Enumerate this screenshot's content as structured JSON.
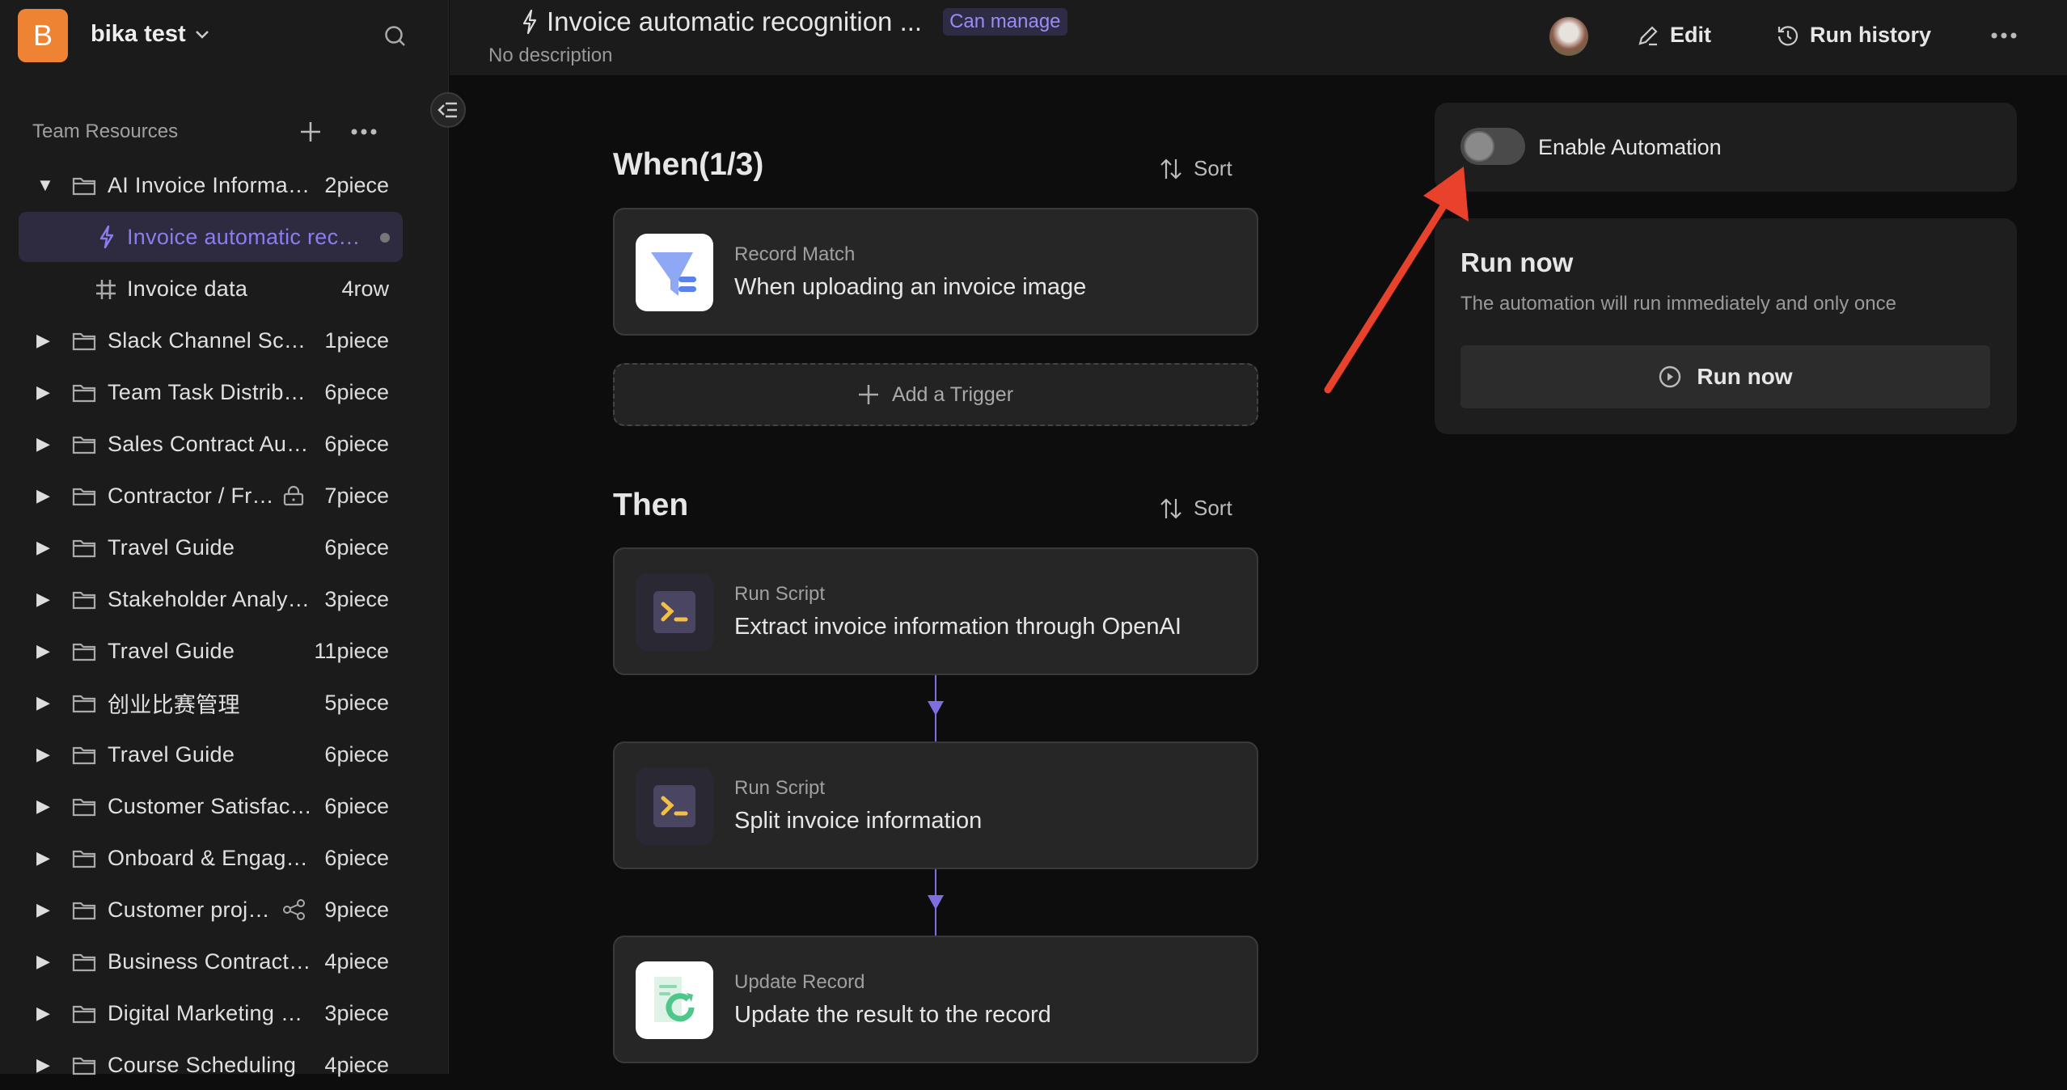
{
  "workspace": {
    "logo_letter": "B",
    "name": "bika test",
    "logo_color": "#ee8433"
  },
  "sidebar": {
    "section_label": "Team Resources",
    "items": [
      {
        "label": "AI Invoice Informa…",
        "count": "2piece",
        "type": "folder",
        "expanded": true
      },
      {
        "label": "Invoice automatic rec…",
        "count": "",
        "type": "automation",
        "selected": true
      },
      {
        "label": "Invoice data",
        "count": "4row",
        "type": "database"
      },
      {
        "label": "Slack Channel Sc…",
        "count": "1piece",
        "type": "folder"
      },
      {
        "label": "Team Task Distrib…",
        "count": "6piece",
        "type": "folder"
      },
      {
        "label": "Sales Contract Au…",
        "count": "6piece",
        "type": "folder"
      },
      {
        "label": "Contractor / Fr…",
        "count": "7piece",
        "type": "folder",
        "icon": "lock-icon"
      },
      {
        "label": "Travel Guide",
        "count": "6piece",
        "type": "folder"
      },
      {
        "label": "Stakeholder Analy…",
        "count": "3piece",
        "type": "folder"
      },
      {
        "label": "Travel Guide",
        "count": "11piece",
        "type": "folder"
      },
      {
        "label": "创业比赛管理",
        "count": "5piece",
        "type": "folder"
      },
      {
        "label": "Travel Guide",
        "count": "6piece",
        "type": "folder"
      },
      {
        "label": "Customer Satisfac…",
        "count": "6piece",
        "type": "folder"
      },
      {
        "label": "Onboard & Engag…",
        "count": "6piece",
        "type": "folder"
      },
      {
        "label": "Customer proj…",
        "count": "9piece",
        "type": "folder",
        "icon": "share-icon"
      },
      {
        "label": "Business Contract…",
        "count": "4piece",
        "type": "folder"
      },
      {
        "label": "Digital Marketing …",
        "count": "3piece",
        "type": "folder"
      },
      {
        "label": "Course Scheduling",
        "count": "4piece",
        "type": "folder"
      }
    ]
  },
  "header": {
    "title": "Invoice automatic recognition ...",
    "permission": "Can manage",
    "description": "No description",
    "edit": "Edit",
    "run_history": "Run history"
  },
  "when": {
    "title": "When(1/3)",
    "sort": "Sort",
    "triggers": [
      {
        "type": "Record Match",
        "label": "When uploading an invoice image"
      }
    ],
    "add_trigger": "Add a Trigger"
  },
  "then": {
    "title": "Then",
    "sort": "Sort",
    "actions": [
      {
        "type": "Run Script",
        "label": "Extract invoice information through OpenAI"
      },
      {
        "type": "Run Script",
        "label": "Split invoice information"
      },
      {
        "type": "Update Record",
        "label": "Update the result to the record"
      }
    ]
  },
  "panel": {
    "enable_label": "Enable Automation",
    "enabled": false,
    "run_title": "Run now",
    "run_desc": "The automation will run immediately and only once",
    "run_button": "Run now"
  },
  "colors": {
    "accent": "#8b7cf0",
    "annotation_arrow": "#e8412c"
  }
}
